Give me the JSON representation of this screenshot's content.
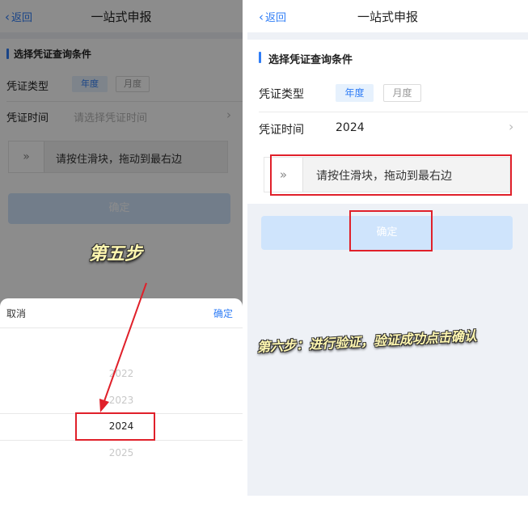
{
  "left": {
    "nav": {
      "back": "返回",
      "title": "一站式申报"
    },
    "section_title": "选择凭证查询条件",
    "fields": {
      "type_label": "凭证类型",
      "type_tab_year": "年度",
      "type_tab_month": "月度",
      "time_label": "凭证时间",
      "time_placeholder": "请选择凭证时间"
    },
    "slider_text": "请按住滑块，拖动到最右边",
    "confirm": "确定",
    "caption": "第五步",
    "sheet": {
      "cancel": "取消",
      "ok": "确定",
      "years": [
        "2022",
        "2023",
        "2024",
        "2025"
      ],
      "selected_year": "2024"
    }
  },
  "right": {
    "nav": {
      "back": "返回",
      "title": "一站式申报"
    },
    "section_title": "选择凭证查询条件",
    "fields": {
      "type_label": "凭证类型",
      "type_tab_year": "年度",
      "type_tab_month": "月度",
      "time_label": "凭证时间",
      "time_value": "2024"
    },
    "slider_text": "请按住滑块，拖动到最右边",
    "confirm": "确定",
    "caption": "第六步：进行验证，验证成功点击确认"
  },
  "colors": {
    "accent": "#2f7df6",
    "highlight_box": "#e0202a",
    "confirm_disabled": "#cfe4fc",
    "caption": "#fff7b0"
  },
  "icons": {
    "back": "chevron-left-icon",
    "row_arrow": "chevron-right-icon",
    "slider_knob": "double-chevron-right-icon",
    "annotation": "arrow-icon"
  }
}
